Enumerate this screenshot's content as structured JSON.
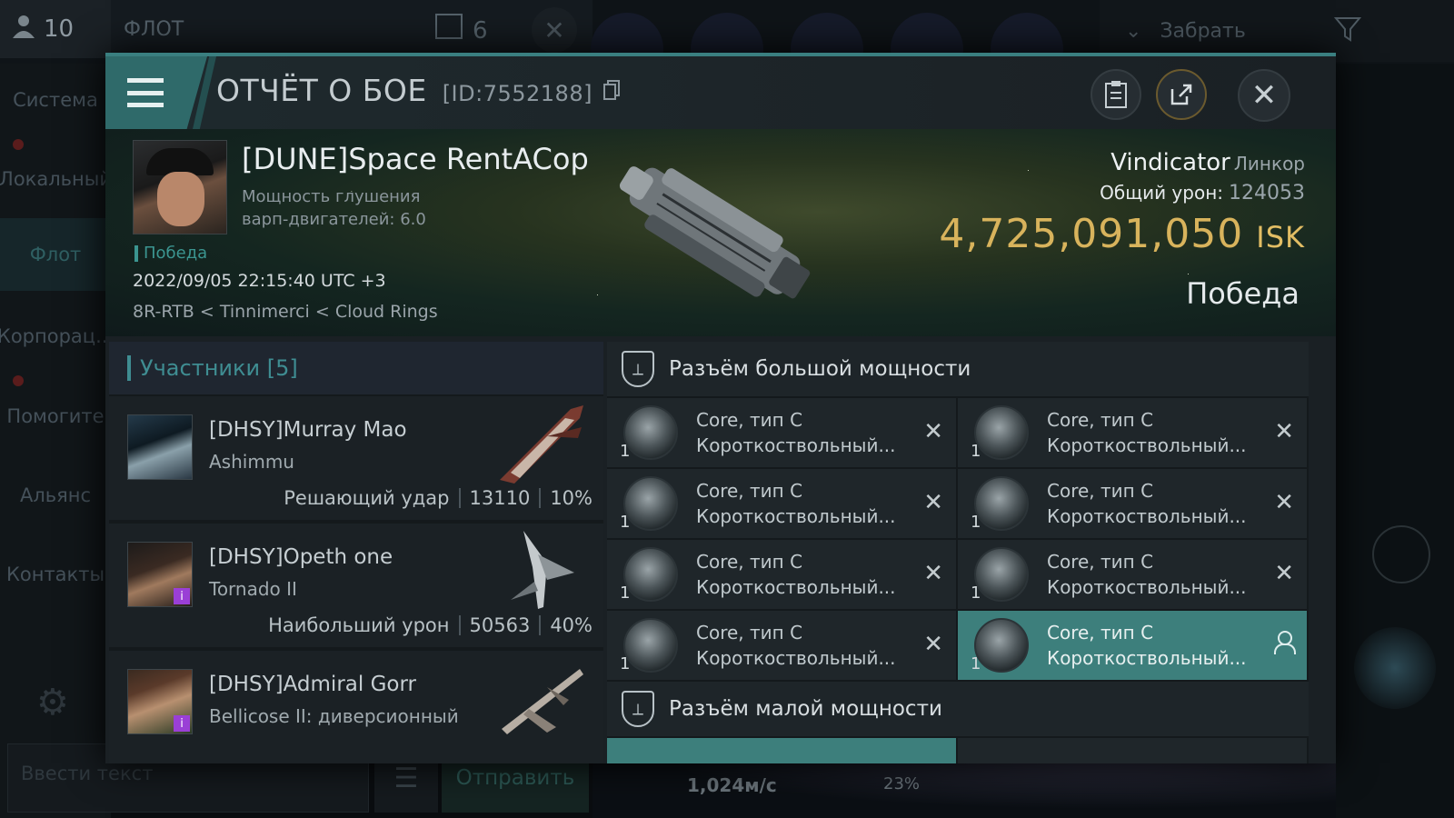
{
  "background": {
    "player_count": "10",
    "fleet_label": "ФЛОТ",
    "fleet_count": "6",
    "take_label": "Забрать",
    "sidebar": [
      "Система",
      "Локальный",
      "Флот",
      "Корпорац...",
      "Помогите",
      "Альянс",
      "Контакты"
    ],
    "chat_placeholder": "Ввести текст",
    "send_label": "Отправить",
    "speed": "1,024м/с",
    "percent": "23%"
  },
  "report": {
    "title": "ОТЧЁТ О БОЕ",
    "id": "[ID:7552188]",
    "pilot": {
      "name": "[DUNE]Space RentACop",
      "sub_line1": "Мощность глушения",
      "sub_line2": "варп-двигателей: 6.0",
      "tag": "Победа",
      "datetime": "2022/09/05 22:15:40 UTC +3",
      "location": "8R-RTB < Tinnimerci < Cloud Rings"
    },
    "ship": {
      "name": "Vindicator",
      "class": "Линкор",
      "damage_label": "Общий урон:",
      "damage_value": "124053",
      "isk_value": "4,725,091,050",
      "isk_unit": "ISK",
      "result": "Победа"
    }
  },
  "participants": {
    "title": "Участники [5]",
    "rows": [
      {
        "name": "[DHSY]Murray Mao",
        "ship": "Ashimmu",
        "role": "Решающий удар",
        "damage": "13110",
        "pct": "10%"
      },
      {
        "name": "[DHSY]Opeth one",
        "ship": "Tornado II",
        "role": "Наибольший урон",
        "damage": "50563",
        "pct": "40%"
      },
      {
        "name": "[DHSY]Admiral Gorr",
        "ship": "Bellicose II: диверсионный",
        "role": "",
        "damage": "",
        "pct": ""
      }
    ]
  },
  "slots": {
    "high_title": "Разъём большой мощности",
    "low_title": "Разъём малой мощности",
    "items": [
      {
        "qty": "1",
        "line1": "Core, тип C",
        "line2": "Короткоствольный..."
      },
      {
        "qty": "1",
        "line1": "Core, тип C",
        "line2": "Короткоствольный..."
      },
      {
        "qty": "1",
        "line1": "Core, тип C",
        "line2": "Короткоствольный..."
      },
      {
        "qty": "1",
        "line1": "Core, тип C",
        "line2": "Короткоствольный..."
      },
      {
        "qty": "1",
        "line1": "Core, тип C",
        "line2": "Короткоствольный..."
      },
      {
        "qty": "1",
        "line1": "Core, тип C",
        "line2": "Короткоствольный..."
      },
      {
        "qty": "1",
        "line1": "Core, тип C",
        "line2": "Короткоствольный..."
      },
      {
        "qty": "1",
        "line1": "Core, тип C",
        "line2": "Короткоствольный..."
      }
    ]
  },
  "colors": {
    "accent": "#3f8d92",
    "isk": "#d8b35c",
    "active_slot": "#3d7f7c"
  },
  "icons": [
    "menu-icon",
    "copy-icon",
    "clipboard-icon",
    "share-icon",
    "close-icon",
    "shield-icon",
    "module-icon",
    "remove-icon",
    "user-icon"
  ]
}
